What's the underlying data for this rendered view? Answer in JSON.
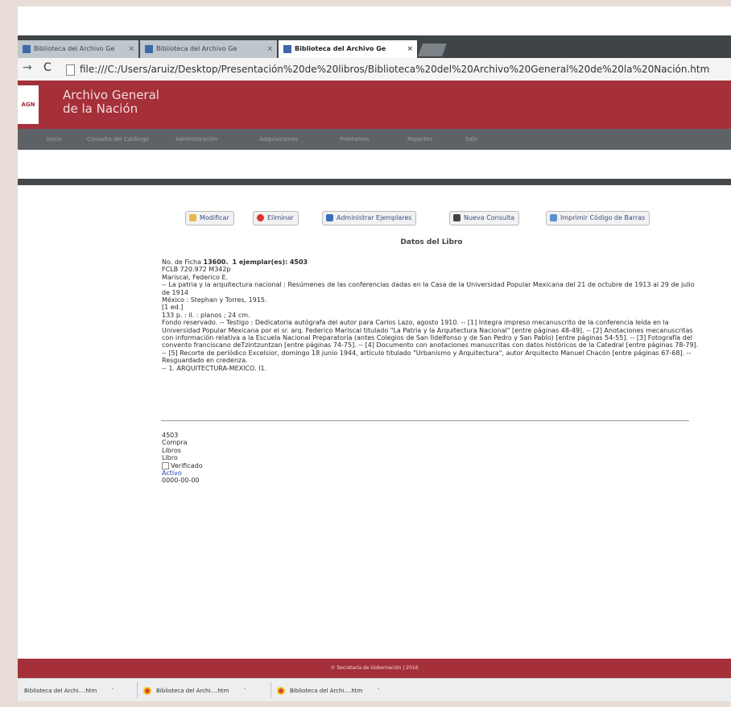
{
  "browser": {
    "tabs": [
      {
        "label": "Biblioteca del Archivo Ge"
      },
      {
        "label": "Biblioteca del Archivo Ge"
      },
      {
        "label": "Biblioteca del Archivo Ge"
      }
    ],
    "url": "file:///C:/Users/aruiz/Desktop/Presentación%20de%20libros/Biblioteca%20del%20Archivo%20General%20de%20la%20Nación.htm"
  },
  "header": {
    "logo": "AGN",
    "title_line1": "Archivo General",
    "title_line2": "de la Nación"
  },
  "menu": [
    "Inicio",
    "Consulta del Catálogo",
    "Administración",
    "Adquisiciones",
    "Préstamos",
    "Reportes",
    "Salir"
  ],
  "toolbar": {
    "modify": "Modificar",
    "delete": "Eliminar",
    "manage_copies": "Administrar Ejemplares",
    "new_query": "Nueva Consulta",
    "print_barcode": "Imprimir Código de Barras"
  },
  "section_title": "Datos del Libro",
  "record": {
    "ficha_label": "No. de Ficha",
    "ficha_number": "13600.",
    "copies_label": "1 ejemplar(es):",
    "copies_id": "4503",
    "call_number": "FCLB 720.972 M342p",
    "author": "Mariscal, Federico E.",
    "title": "-- La patria y la arquitectura nacional : Resúmenes de las conferencias dadas en la Casa de la Universidad Popular Mexicana del 21 de octubre de 1913 al 29 de julio de 1914",
    "publication": "México : Stephan y Torres, 1915.",
    "edition": "[1 ed.]",
    "physical": "133 p. : il. : planos ; 24 cm.",
    "notes": "Fondo reservado. -- Testigo : Dedicatoria autógrafa del autor para Carlos Lazo, agosto 1910. -- [1] Integra impreso mecanuscrito de la conferencia leída en la Universidad Popular Mexicana por el sr. arq. Federico Mariscal titulado \"La Patria y la Arquitectura Nacional\" [entre páginas 48-49]. -- [2] Anotaciones mecanuscritas con información relativa a la Escuela Nacional Preparatoria (antes Colegios de San Ildelfonso y de San Pedro y San Pablo) [entre páginas 54-55]. -- [3] Fotografía del convento franciscano deTzintzuntzan [entre páginas 74-75]. -- [4] Documento con anotaciones manuscritas con datos históricos de la Catedral [entre páginas 78-79]. -- [5] Recorte de periódico Excelsior, domingo 18 junio 1944, artículo titulado \"Urbanismo y Arquitectura\", autor Arquitecto Manuel Chacón [entre páginas 67-68]. -- Resguardado en credenza.",
    "subjects": "-- 1. ARQUITECTURA-MEXICO. I1."
  },
  "copy": {
    "id": "4503",
    "acquisition": "Compra",
    "collection": "Libros",
    "material": "Libro",
    "verified_label": "Verificado",
    "status": "Activo",
    "date": "0000-00-00"
  },
  "footer": "© Secretaría de Gobernación | 2016",
  "downloads": [
    {
      "label": "Biblioteca del Archi....htm"
    },
    {
      "label": "Biblioteca del Archi....htm"
    },
    {
      "label": "Biblioteca del Archi....htm"
    }
  ],
  "colors": {
    "header_red": "#a5303a",
    "menu_gray": "#5e6266",
    "link_blue": "#2a3fb0"
  }
}
